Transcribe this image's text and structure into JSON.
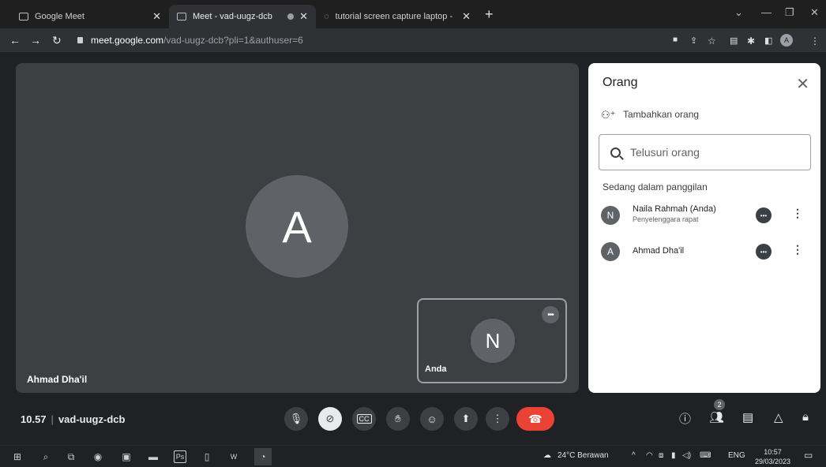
{
  "browser": {
    "tabs": [
      {
        "title": "Google Meet",
        "active": false
      },
      {
        "title": "Meet - vad-uugz-dcb",
        "active": true
      },
      {
        "title": "tutorial screen capture laptop - I",
        "active": false
      }
    ],
    "url_host": "meet.google.com",
    "url_path": "/vad-uugz-dcb?pli=1&authuser=6",
    "profile_initial": "A"
  },
  "stage": {
    "main_avatar": "A",
    "main_name": "Ahmad Dha'il",
    "self_avatar": "N",
    "self_name": "Anda"
  },
  "panel": {
    "title": "Orang",
    "add_label": "Tambahkan orang",
    "search_placeholder": "Telusuri orang",
    "section_label": "Sedang dalam panggilan",
    "people": [
      {
        "initial": "N",
        "name": "Naila Rahmah (Anda)",
        "role": "Penyelenggara rapat"
      },
      {
        "initial": "A",
        "name": "Ahmad Dha'il",
        "role": ""
      }
    ]
  },
  "footer": {
    "time": "10.57",
    "meeting_code": "vad-uugz-dcb",
    "participants_badge": "2"
  },
  "taskbar": {
    "weather": "24°C Berawan",
    "lang": "ENG",
    "clock_time": "10:57",
    "clock_date": "29/03/2023"
  }
}
